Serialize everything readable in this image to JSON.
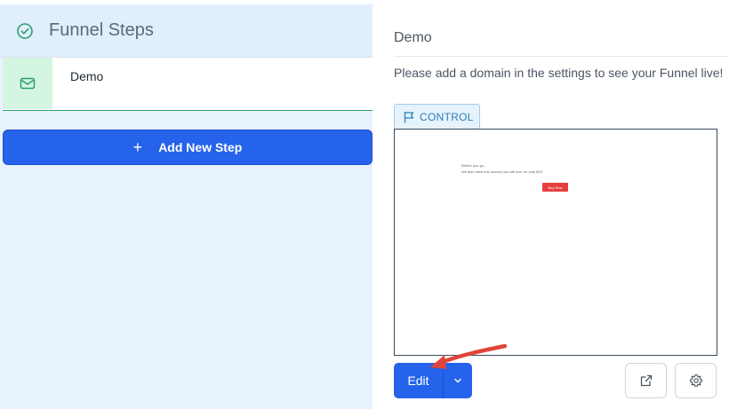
{
  "sidebar": {
    "title": "Funnel Steps",
    "steps": [
      {
        "label": "Demo",
        "icon": "mail-icon"
      }
    ],
    "add_step_label": "Add New Step"
  },
  "main": {
    "step_title": "Demo",
    "notice": "Please add a domain in the settings to see your Funnel live!",
    "variant_tab": "CONTROL",
    "preview": {
      "line1": "Before you go...",
      "line2": "We also have this product you will love for only $XX",
      "button": "Buy Now"
    },
    "edit_label": "Edit"
  },
  "colors": {
    "accent": "#2563eb",
    "success": "#2f9e6a",
    "annotation_arrow": "#e0443a"
  }
}
